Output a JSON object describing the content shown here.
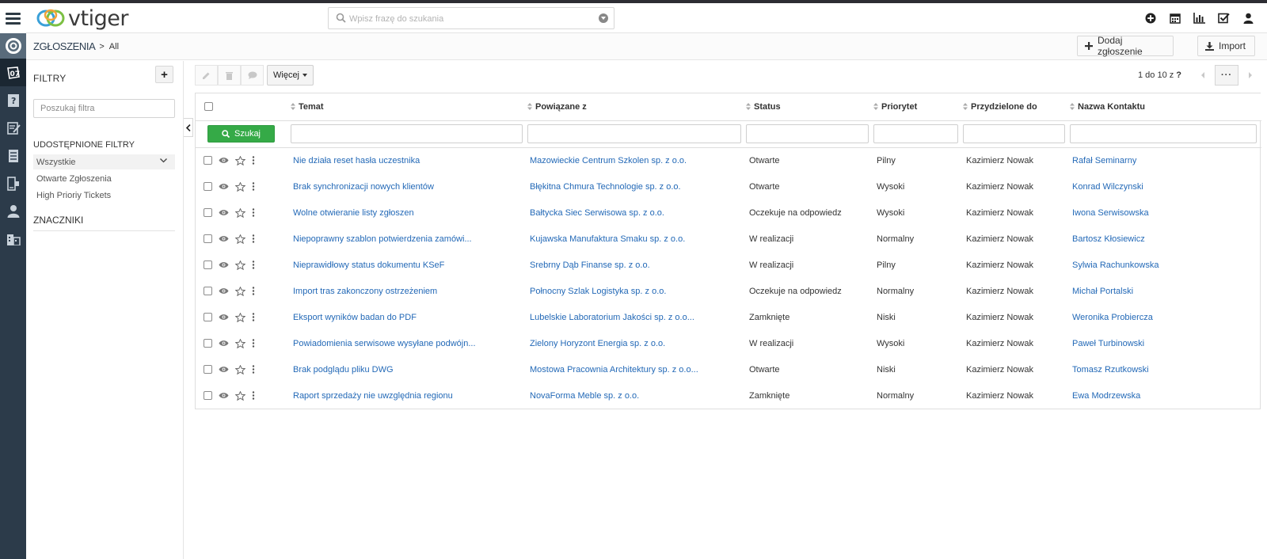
{
  "app": {
    "name": "vtiger"
  },
  "header": {
    "search_placeholder": "Wpisz frazę do szukania",
    "icons": [
      "plus-circle-icon",
      "calendar-icon",
      "bar-chart-icon",
      "task-check-icon",
      "user-icon"
    ]
  },
  "leftbar": {
    "icons": [
      "helpdesk-lifebuoy-icon",
      "tickets-icon",
      "faq-icon",
      "service-contracts-icon",
      "products-icon",
      "assets-icon",
      "contacts-icon",
      "organizations-icon"
    ]
  },
  "breadcrumb": {
    "module": "ZGŁOSZENIA",
    "separator": ">",
    "view": "All"
  },
  "header_buttons": {
    "add": "Dodaj zgłoszenie",
    "import": "Import"
  },
  "sidebar": {
    "title": "FILTRY",
    "add_label": "+",
    "search_placeholder": "Poszukaj filtra",
    "shared_title": "UDOSTĘPNIONE FILTRY",
    "filters": [
      "Wszystkie",
      "Otwarte Zgłoszenia",
      "High Prioriy Tickets"
    ],
    "tags_title": "ZNACZNIKI"
  },
  "toolbar": {
    "more_label": "Więcej",
    "pager_text": "1 do 10  z",
    "pager_q": "?",
    "pager_more": "···"
  },
  "table": {
    "search_label": "Szukaj",
    "columns": [
      "Temat",
      "Powiązane z",
      "Status",
      "Priorytet",
      "Przydzielone do",
      "Nazwa Kontaktu"
    ],
    "rows": [
      [
        "Nie działa reset hasła uczestnika",
        "Mazowieckie Centrum Szkolen sp. z o.o.",
        "Otwarte",
        "Pilny",
        "Kazimierz Nowak",
        "Rafał Seminarny"
      ],
      [
        "Brak synchronizacji nowych klientów",
        "Błękitna Chmura Technologie sp. z o.o.",
        "Otwarte",
        "Wysoki",
        "Kazimierz Nowak",
        "Konrad Wilczynski"
      ],
      [
        "Wolne otwieranie listy zgłoszen",
        "Bałtycka Siec Serwisowa sp. z o.o.",
        "Oczekuje na odpowiedz",
        "Wysoki",
        "Kazimierz Nowak",
        "Iwona Serwisowska"
      ],
      [
        "Niepoprawny szablon potwierdzenia zamówi...",
        "Kujawska Manufaktura Smaku sp. z o.o.",
        "W realizacji",
        "Normalny",
        "Kazimierz Nowak",
        "Bartosz Kłosiewicz"
      ],
      [
        "Nieprawidłowy status dokumentu KSeF",
        "Srebrny Dąb Finanse sp. z o.o.",
        "W realizacji",
        "Pilny",
        "Kazimierz Nowak",
        "Sylwia Rachunkowska"
      ],
      [
        "Import tras zakonczony ostrzeżeniem",
        "Połnocny Szlak Logistyka sp. z o.o.",
        "Oczekuje na odpowiedz",
        "Normalny",
        "Kazimierz Nowak",
        "Michał Portalski"
      ],
      [
        "Eksport wyników badan do PDF",
        "Lubelskie Laboratorium Jakości sp. z o.o...",
        "Zamknięte",
        "Niski",
        "Kazimierz Nowak",
        "Weronika Probiercza"
      ],
      [
        "Powiadomienia serwisowe wysyłane podwójn...",
        "Zielony Horyzont Energia sp. z o.o.",
        "W realizacji",
        "Wysoki",
        "Kazimierz Nowak",
        "Paweł Turbinowski"
      ],
      [
        "Brak podglądu pliku DWG",
        "Mostowa Pracownia Architektury sp. z o.o...",
        "Otwarte",
        "Niski",
        "Kazimierz Nowak",
        "Tomasz Rzutkowski"
      ],
      [
        "Raport sprzedaży nie uwzględnia regionu",
        "NovaForma Meble sp. z o.o.",
        "Zamknięte",
        "Normalny",
        "Kazimierz Nowak",
        "Ewa Modrzewska"
      ]
    ]
  },
  "colors": {
    "accent_link": "#2369b7",
    "search_button": "#35aa47",
    "leftbar": "#2c3b4a"
  }
}
